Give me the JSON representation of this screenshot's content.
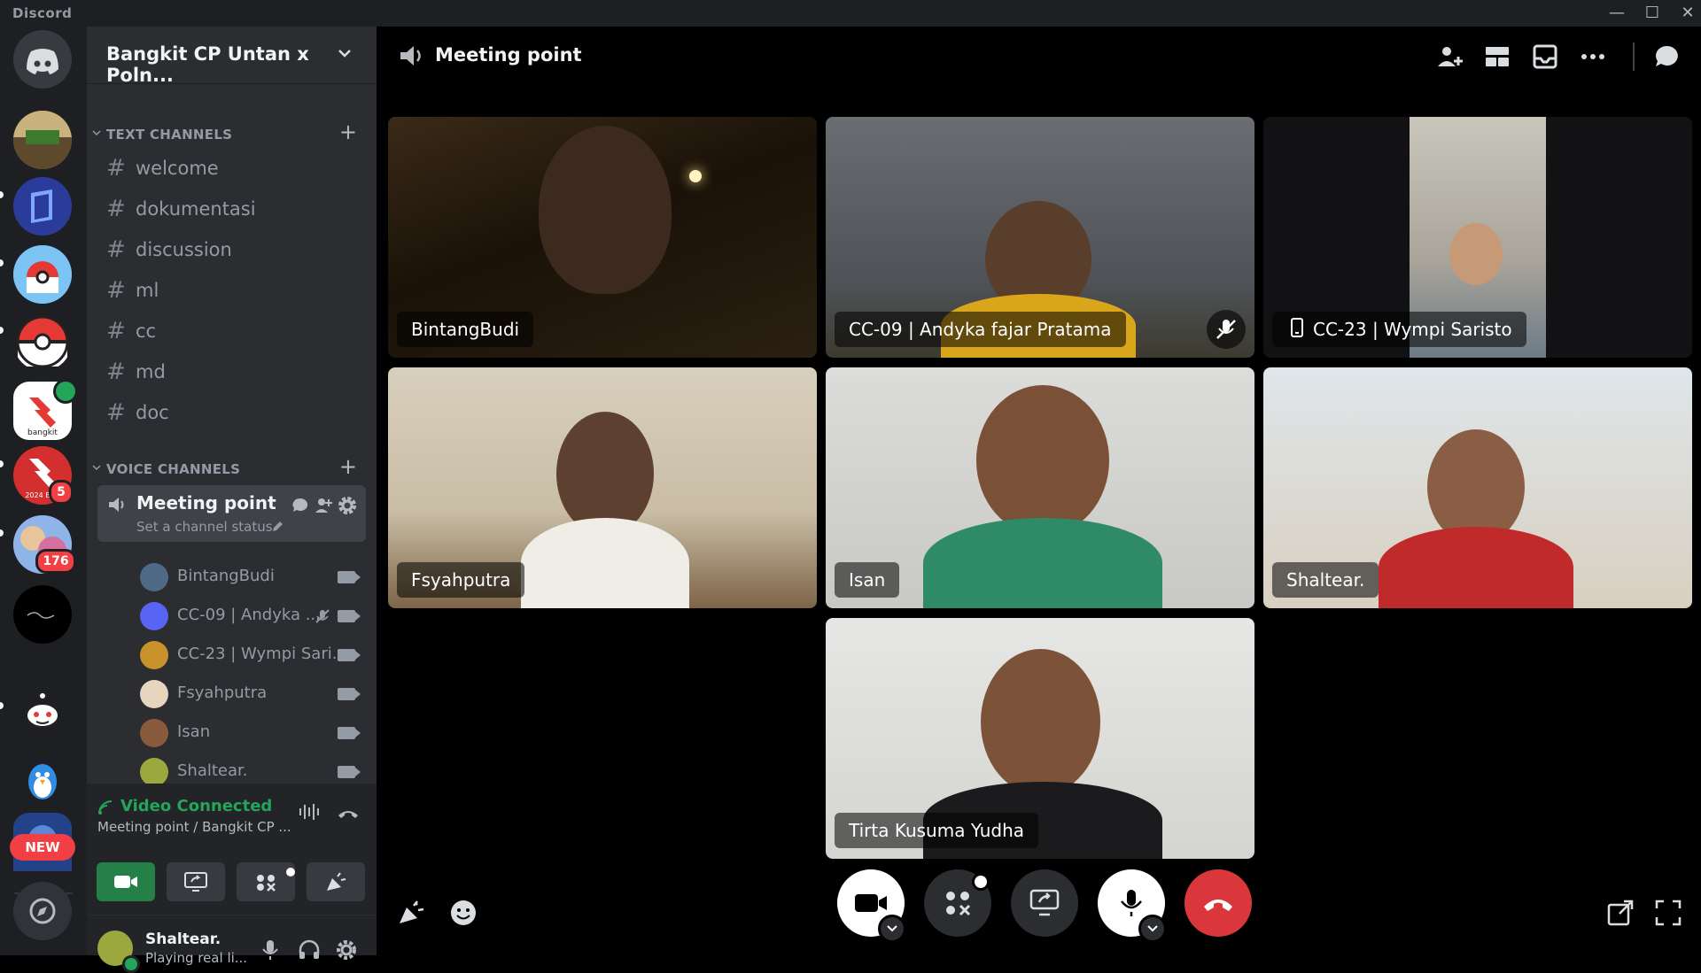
{
  "app": {
    "name": "Discord"
  },
  "window": {
    "minimize": "—",
    "maximize": "☐",
    "close": "✕"
  },
  "guilds": {
    "badges": [
      "5",
      "176"
    ],
    "new_label": "NEW"
  },
  "server": {
    "name": "Bangkit CP Untan x Poln...",
    "text_category": "TEXT CHANNELS",
    "voice_category": "VOICE CHANNELS",
    "text_channels": [
      "welcome",
      "dokumentasi",
      "discussion",
      "ml",
      "cc",
      "md",
      "doc"
    ],
    "voice_channel": {
      "name": "Meeting point",
      "status": "Set a channel status",
      "members": [
        "BintangBudi",
        "CC-09 | Andyka ...",
        "CC-23 | Wympi Sari...",
        "Fsyahputra",
        "Isan",
        "Shaltear."
      ]
    }
  },
  "voice_panel": {
    "title": "Video Connected",
    "subtitle": "Meeting point / Bangkit CP ..."
  },
  "user": {
    "name": "Shaltear.",
    "status": "Playing real li..."
  },
  "header": {
    "channel": "Meeting point"
  },
  "participants": [
    "BintangBudi",
    "CC-09 | Andyka fajar Pratama",
    "CC-23 | Wympi Saristo",
    "Fsyahputra",
    "Isan",
    "Shaltear.",
    "Tirta Kusuma Yudha"
  ],
  "colors": {
    "connected": "#23a55a",
    "hangup": "#da373c",
    "badge": "#f23f43",
    "camera_on": "#23a55a"
  }
}
